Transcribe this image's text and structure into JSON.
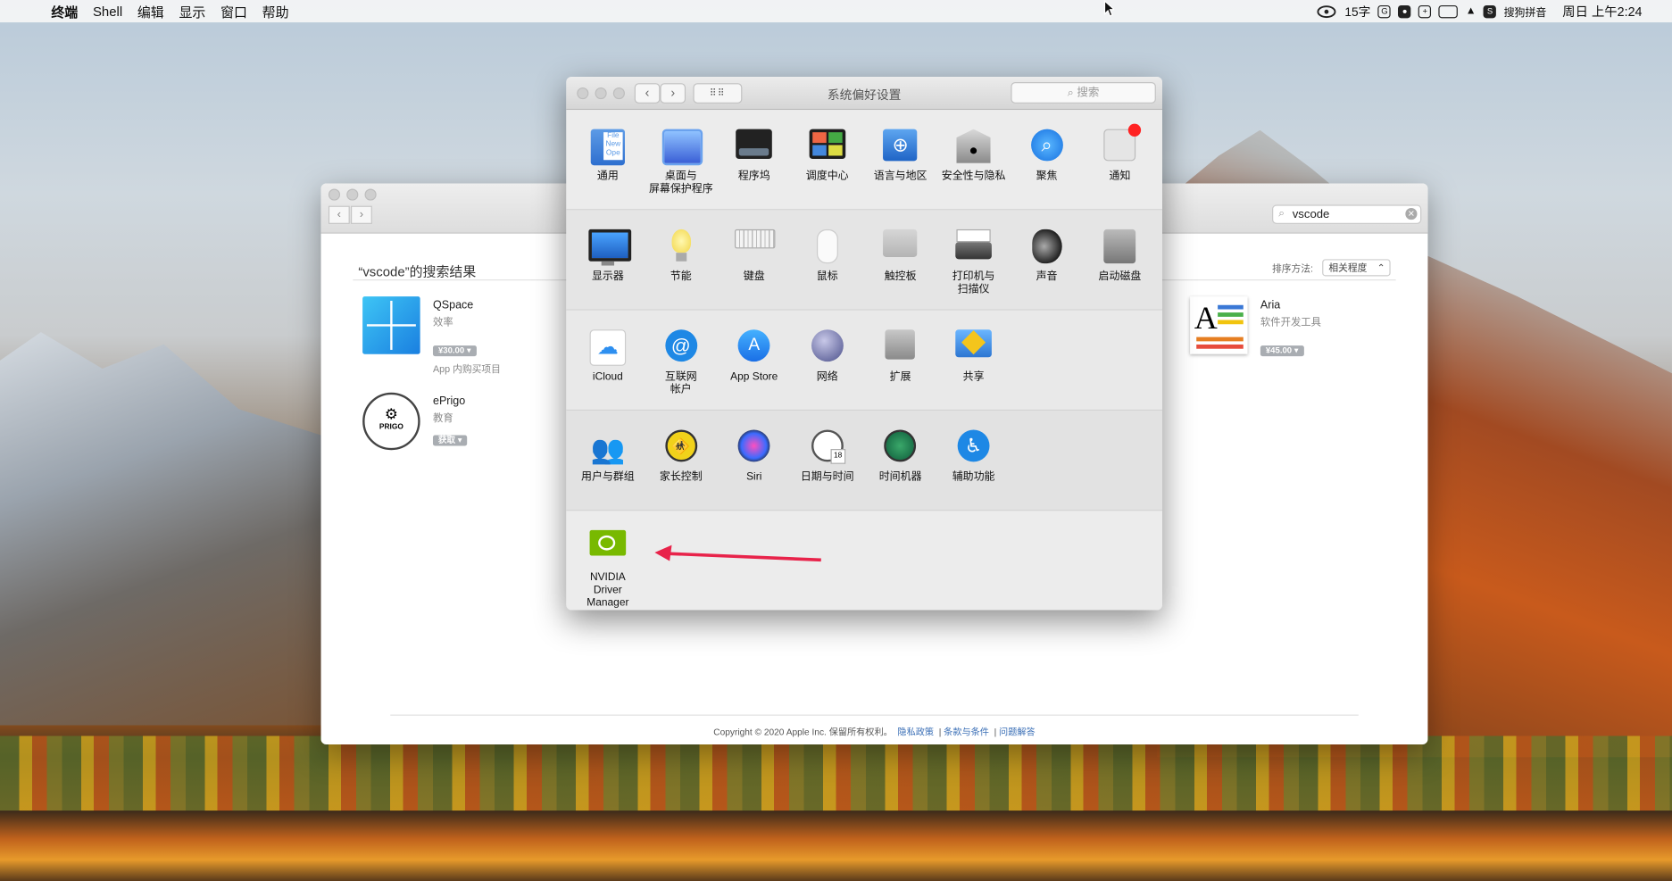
{
  "menubar": {
    "items": [
      "终端",
      "Shell",
      "编辑",
      "显示",
      "窗口",
      "帮助"
    ],
    "status": {
      "char_count": "15字",
      "ime": "搜狗拼音",
      "datetime": "周日 上午2:24"
    }
  },
  "store": {
    "search_value": "vscode",
    "results_title": "“vscode”的搜索结果",
    "sort_label": "排序方法:",
    "sort_value": "相关程度",
    "apps": [
      {
        "name": "QSpace",
        "category": "效率",
        "price": "¥30.00",
        "note": "App 内购买项目"
      },
      {
        "name": "ePrigo",
        "category": "教育",
        "price": "获取",
        "note": ""
      },
      {
        "name": "Aria",
        "category": "软件开发工具",
        "price": "¥45.00",
        "note": ""
      }
    ],
    "footer": {
      "copyright": "Copyright © 2020 Apple Inc. 保留所有权利。",
      "links": [
        "隐私政策",
        "条款与条件",
        "问题解答"
      ]
    }
  },
  "prefs": {
    "title": "系统偏好设置",
    "search_placeholder": "搜索",
    "rows": [
      [
        {
          "label": "通用",
          "icon": "general-icon"
        },
        {
          "label": "桌面与\n屏幕保护程序",
          "icon": "desktop-screensaver-icon"
        },
        {
          "label": "程序坞",
          "icon": "dock-icon"
        },
        {
          "label": "调度中心",
          "icon": "mission-control-icon"
        },
        {
          "label": "语言与地区",
          "icon": "language-region-icon"
        },
        {
          "label": "安全性与隐私",
          "icon": "security-privacy-icon"
        },
        {
          "label": "聚焦",
          "icon": "spotlight-icon"
        },
        {
          "label": "通知",
          "icon": "notifications-icon"
        }
      ],
      [
        {
          "label": "显示器",
          "icon": "displays-icon"
        },
        {
          "label": "节能",
          "icon": "energy-saver-icon"
        },
        {
          "label": "键盘",
          "icon": "keyboard-icon"
        },
        {
          "label": "鼠标",
          "icon": "mouse-icon"
        },
        {
          "label": "触控板",
          "icon": "trackpad-icon"
        },
        {
          "label": "打印机与\n扫描仪",
          "icon": "printers-scanners-icon"
        },
        {
          "label": "声音",
          "icon": "sound-icon"
        },
        {
          "label": "启动磁盘",
          "icon": "startup-disk-icon"
        }
      ],
      [
        {
          "label": "iCloud",
          "icon": "icloud-icon"
        },
        {
          "label": "互联网\n帐户",
          "icon": "internet-accounts-icon"
        },
        {
          "label": "App Store",
          "icon": "app-store-icon"
        },
        {
          "label": "网络",
          "icon": "network-icon"
        },
        {
          "label": "扩展",
          "icon": "extensions-icon"
        },
        {
          "label": "共享",
          "icon": "sharing-icon"
        }
      ],
      [
        {
          "label": "用户与群组",
          "icon": "users-groups-icon"
        },
        {
          "label": "家长控制",
          "icon": "parental-controls-icon"
        },
        {
          "label": "Siri",
          "icon": "siri-icon"
        },
        {
          "label": "日期与时间",
          "icon": "date-time-icon"
        },
        {
          "label": "时间机器",
          "icon": "time-machine-icon"
        },
        {
          "label": "辅助功能",
          "icon": "accessibility-icon"
        }
      ],
      [
        {
          "label": "NVIDIA\nDriver Manager",
          "icon": "nvidia-icon"
        }
      ]
    ]
  },
  "annotation": {
    "arrow_color": "#e8234a"
  }
}
